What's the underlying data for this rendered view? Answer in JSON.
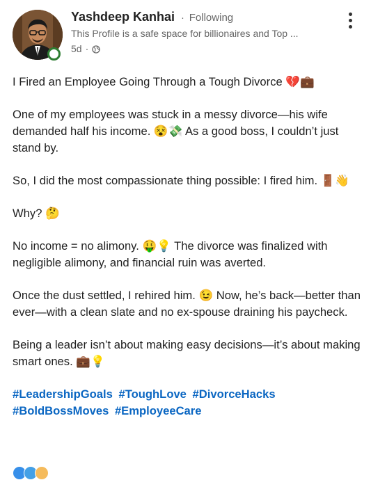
{
  "author": {
    "name": "Yashdeep Kanhai",
    "separator": "·",
    "follow_status": "Following",
    "headline": "This Profile is a safe space for billionaires and Top ...",
    "time": "5d",
    "time_separator": "·",
    "visibility_icon": "globe-icon"
  },
  "menu": {
    "icon": "more-vertical-icon"
  },
  "post": {
    "title": "I Fired an Employee Going Through a Tough Divorce 💔💼",
    "paragraphs": [
      "One of my employees was stuck in a messy divorce—his wife demanded half his income. 😵💸 As a good boss, I couldn’t just stand by.",
      "So, I did the most compassionate thing possible: I fired him. 🚪👋",
      "Why? 🤔",
      "No income = no alimony. 🤑💡 The divorce was finalized with negligible alimony, and financial ruin was averted.",
      "Once the dust settled, I rehired him. 😉 Now, he’s back—better than ever—with a clean slate and no ex-spouse draining his paycheck.",
      "Being a leader isn’t about making easy decisions—it’s about making smart ones. 💼💡"
    ],
    "hashtags": [
      "#LeadershipGoals",
      "#ToughLove",
      "#DivorceHacks",
      "#BoldBossMoves",
      "#EmployeeCare"
    ]
  },
  "colors": {
    "link": "#0a66c2",
    "online": "#2e7d32",
    "muted": "#666666"
  }
}
